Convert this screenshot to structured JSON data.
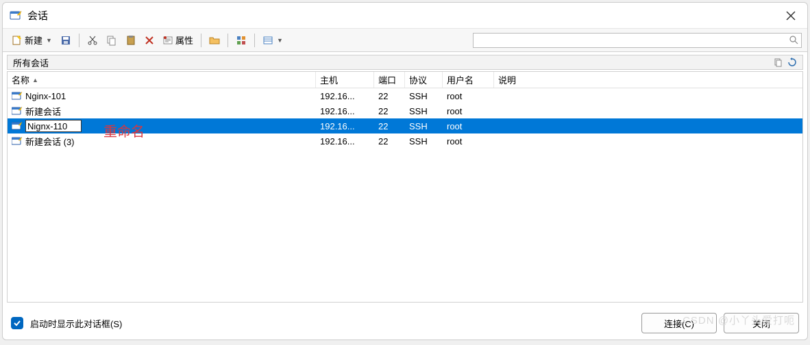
{
  "window": {
    "title": "会话"
  },
  "toolbar": {
    "new_label": "新建",
    "props_label": "属性"
  },
  "folder_bar": {
    "label": "所有会话"
  },
  "columns": {
    "name": "名称",
    "host": "主机",
    "port": "端口",
    "protocol": "协议",
    "user": "用户名",
    "desc": "说明"
  },
  "search": {
    "placeholder": ""
  },
  "sessions": [
    {
      "name": "Nginx-101",
      "host": "192.16...",
      "port": "22",
      "protocol": "SSH",
      "user": "root",
      "desc": "",
      "selected": false,
      "editing": false
    },
    {
      "name": "新建会话",
      "host": "192.16...",
      "port": "22",
      "protocol": "SSH",
      "user": "root",
      "desc": "",
      "selected": false,
      "editing": false
    },
    {
      "name": "Nignx-110",
      "host": "192.16...",
      "port": "22",
      "protocol": "SSH",
      "user": "root",
      "desc": "",
      "selected": true,
      "editing": true
    },
    {
      "name": "新建会话 (3)",
      "host": "192.16...",
      "port": "22",
      "protocol": "SSH",
      "user": "root",
      "desc": "",
      "selected": false,
      "editing": false
    }
  ],
  "annotation": {
    "text": "重命名"
  },
  "footer": {
    "checkbox_label": "启动时显示此对话框(S)",
    "connect": "连接(C)",
    "close": "关闭"
  },
  "watermark": "CSDN @小丫头爱打呃"
}
